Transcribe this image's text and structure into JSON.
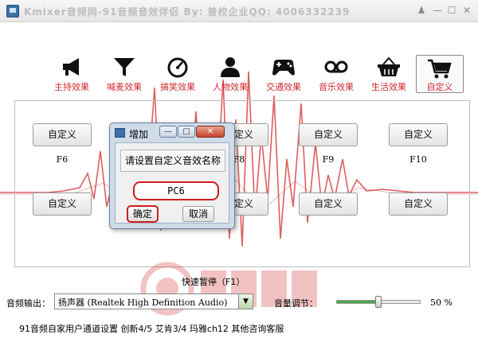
{
  "window": {
    "title": "Kmixer音频网-91音频音效伴侣      By: 普校企业QQ: 4006332239",
    "controls": [
      "person-icon",
      "minimize",
      "maximize",
      "close"
    ]
  },
  "toolbar": {
    "items": [
      {
        "label": "主持效果",
        "icon": "megaphone-icon"
      },
      {
        "label": "喊麦效果",
        "icon": "funnel-icon"
      },
      {
        "label": "搞笑效果",
        "icon": "gauge-icon"
      },
      {
        "label": "人物效果",
        "icon": "person-icon"
      },
      {
        "label": "交通效果",
        "icon": "gamepad-icon"
      },
      {
        "label": "音乐效果",
        "icon": "cassette-icon"
      },
      {
        "label": "生活效果",
        "icon": "basket-icon"
      },
      {
        "label": "自定义",
        "icon": "cart-icon",
        "active": true
      }
    ]
  },
  "grid": {
    "button_label": "自定义",
    "fkeys": [
      "F6",
      "F8",
      "F9",
      "F10"
    ]
  },
  "dialog": {
    "title": "增加",
    "prompt": "请设置自定义音效名称",
    "input_value": "PC6",
    "ok_label": "确定",
    "cancel_label": "取消"
  },
  "hotkey": "快速暂停（F1）",
  "audio_output": {
    "label": "音频输出：",
    "selected": "扬声器 (Realtek High Definition Audio)"
  },
  "volume": {
    "label": "音量调节：",
    "percent_text": "50 %",
    "level": 0.5
  },
  "footer": "91音频自家用户通道设置 创新4/5 艾肯3/4 玛雅ch12 其他咨询客服",
  "colors": {
    "accent": "#d2282b",
    "wave": "#d2282b"
  }
}
